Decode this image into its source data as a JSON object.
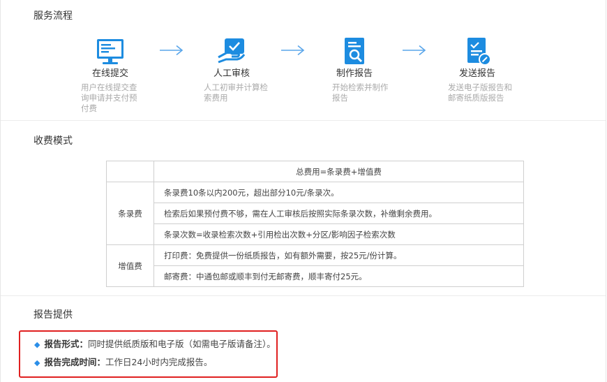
{
  "sections": {
    "process_title": "服务流程",
    "fee_title": "收费模式",
    "report_title": "报告提供"
  },
  "steps": [
    {
      "name": "在线提交",
      "desc": "用户在线提交查询申请并支付预付费",
      "icon": "monitor-icon",
      "color": "#1d8ce0"
    },
    {
      "name": "人工审核",
      "desc": "人工初审并计算检索费用",
      "icon": "hand-check-icon",
      "color": "#1d8ce0"
    },
    {
      "name": "制作报告",
      "desc": "开始检索并制作报告",
      "icon": "document-search-icon",
      "color": "#1d8ce0"
    },
    {
      "name": "发送报告",
      "desc": "发送电子版报告和邮寄纸质版报告",
      "icon": "document-send-icon",
      "color": "#1d8ce0"
    }
  ],
  "fee_table": {
    "header": "总费用=条录费+增值费",
    "groups": [
      {
        "category": "条录费",
        "rows": [
          "条录费10条以内200元，超出部分10元/条录次。",
          "检索后如果预付费不够，需在人工审核后按照实际条录次数，补缴剩余费用。",
          "条录次数=收录检索次数+引用检出次数+分区/影响因子检索次数"
        ]
      },
      {
        "category": "增值费",
        "rows": [
          "打印费：免费提供一份纸质报告，如有额外需要，按25元/份计算。",
          "邮寄费：中通包邮或顺丰到付无邮寄费，顺丰寄付25元。"
        ]
      }
    ]
  },
  "report": {
    "items": [
      {
        "label": "报告形式：",
        "text": "同时提供纸质版和电子版（如需电子版请备注）。"
      },
      {
        "label": "报告完成时间：",
        "text": "工作日24小时内完成报告。"
      }
    ],
    "highlight_color": "#e02020",
    "bullet_color": "#2a8ee8"
  }
}
